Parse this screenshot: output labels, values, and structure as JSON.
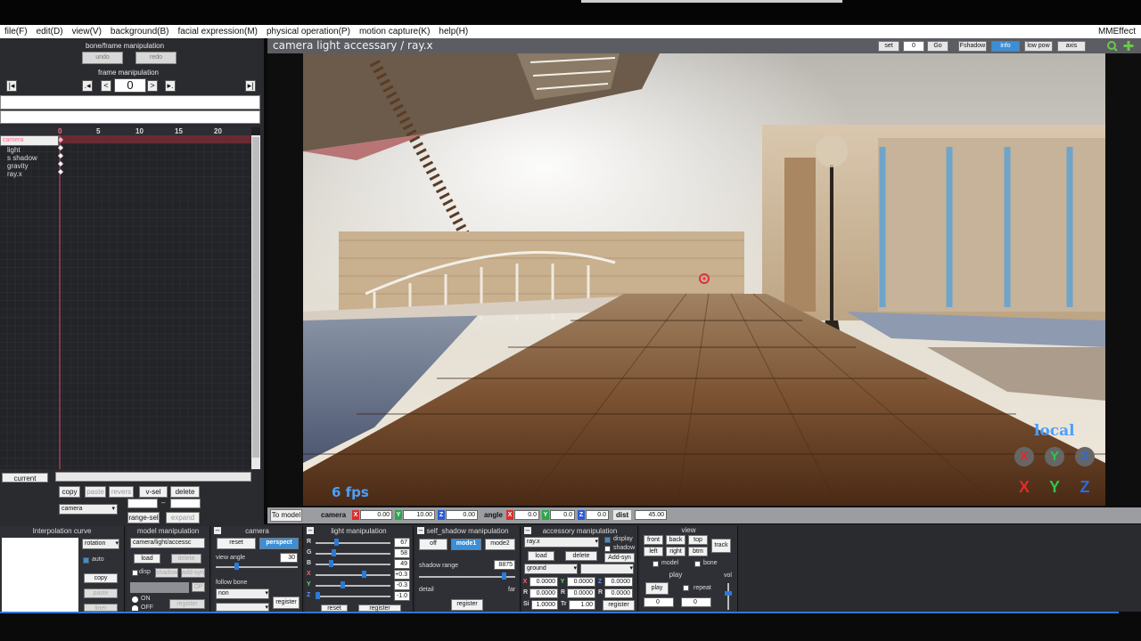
{
  "menu": {
    "items": [
      "file(F)",
      "edit(D)",
      "view(V)",
      "background(B)",
      "facial expression(M)",
      "physical operation(P)",
      "motion capture(K)",
      "help(H)"
    ],
    "brand": "MMEffect"
  },
  "left": {
    "bone_header": "bone/frame manipulation",
    "undo": "undo",
    "redo": "redo",
    "frame_header": "frame manipulation",
    "frame_value": "0",
    "ruler": [
      "0",
      "5",
      "10",
      "15",
      "20"
    ],
    "tracks": [
      "camera",
      "light",
      "s shadow",
      "gravity",
      "ray.x"
    ],
    "current": "current",
    "copy": "copy",
    "paste": "paste",
    "revers": "revers",
    "vsel": "v-sel",
    "delete": "delete",
    "dash": "–",
    "camera_select": "camera",
    "range_sel": "range-sel",
    "expand": "expand"
  },
  "viewport": {
    "title": "camera light accessary / ray.x",
    "set": "set",
    "frame": "0",
    "go": "Go",
    "fshadow": "Fshadow",
    "info": "info",
    "lowpow": "low pow",
    "axis": "axis",
    "fps": "6 fps",
    "local": "local",
    "gizmo_top": [
      "X",
      "Y",
      "Z"
    ],
    "gizmo_bottom": [
      "X",
      "Y",
      "Z"
    ]
  },
  "camrow": {
    "to_model": "To model",
    "camera": "camera",
    "cx": "0.00",
    "cy": "10.00",
    "cz": "0.00",
    "angle": "angle",
    "ax": "0.0",
    "ay": "0.0",
    "az": "0.0",
    "dist": "dist",
    "dist_val": "45.00",
    "x": "X",
    "y": "Y",
    "z": "Z"
  },
  "interp": {
    "header": "Interpolation curve",
    "rotation": "rotation",
    "auto": "auto",
    "copy": "copy",
    "paste": "paste",
    "liner": "liner"
  },
  "model": {
    "header": "model manipulation",
    "select": "camera/light/accessc",
    "load": "load",
    "delete": "delete",
    "disp": "disp",
    "shadow": "shadow",
    "addsyn": "add-syn",
    "op": "OP",
    "on": "ON",
    "off": "OFF",
    "register": "register"
  },
  "camera": {
    "header": "camera",
    "reset": "reset",
    "perspect": "perspect",
    "view_angle": "view angle",
    "angle_val": "30",
    "follow_bone": "follow bone",
    "non": "non",
    "register": "register"
  },
  "light": {
    "header": "light manipulation",
    "rows": [
      {
        "k": "R",
        "v": "67",
        "level": 0.26
      },
      {
        "k": "G",
        "v": "58",
        "level": 0.23
      },
      {
        "k": "B",
        "v": "49",
        "level": 0.19
      },
      {
        "k": "X",
        "v": "+0.3",
        "level": 0.65
      },
      {
        "k": "Y",
        "v": "-0.3",
        "level": 0.35
      },
      {
        "k": "Z",
        "v": "-1.0",
        "level": 0.0
      }
    ],
    "reset": "reset",
    "register": "register"
  },
  "shadow": {
    "header": "self_shadow manipulation",
    "off": "off",
    "mode1": "mode1",
    "mode2": "mode2",
    "range_label": "shadow range",
    "range_val": "8875",
    "level": 0.89,
    "detail": "detail",
    "far": "far",
    "register": "register"
  },
  "accessory": {
    "header": "accessory manipulation",
    "select": "ray.x",
    "display": "display",
    "shadow": "shadow",
    "load": "load",
    "delete": "delete",
    "addsyn": "Add-syn",
    "parent": "ground",
    "x": "0.0000",
    "y": "0.0000",
    "z": "0.0000",
    "rx": "0.0000",
    "ry": "0.0000",
    "rz": "0.0000",
    "si": "1.0000",
    "tr": "1.00",
    "register": "register"
  },
  "view": {
    "header": "view",
    "front": "front",
    "back": "back",
    "top": "top",
    "track": "track",
    "left": "left",
    "right": "right",
    "btm": "btm",
    "model": "model",
    "bone": "bone",
    "play_header": "play",
    "play": "play",
    "repeat": "repeat",
    "from": "0",
    "to": "0",
    "vol": "vol"
  }
}
